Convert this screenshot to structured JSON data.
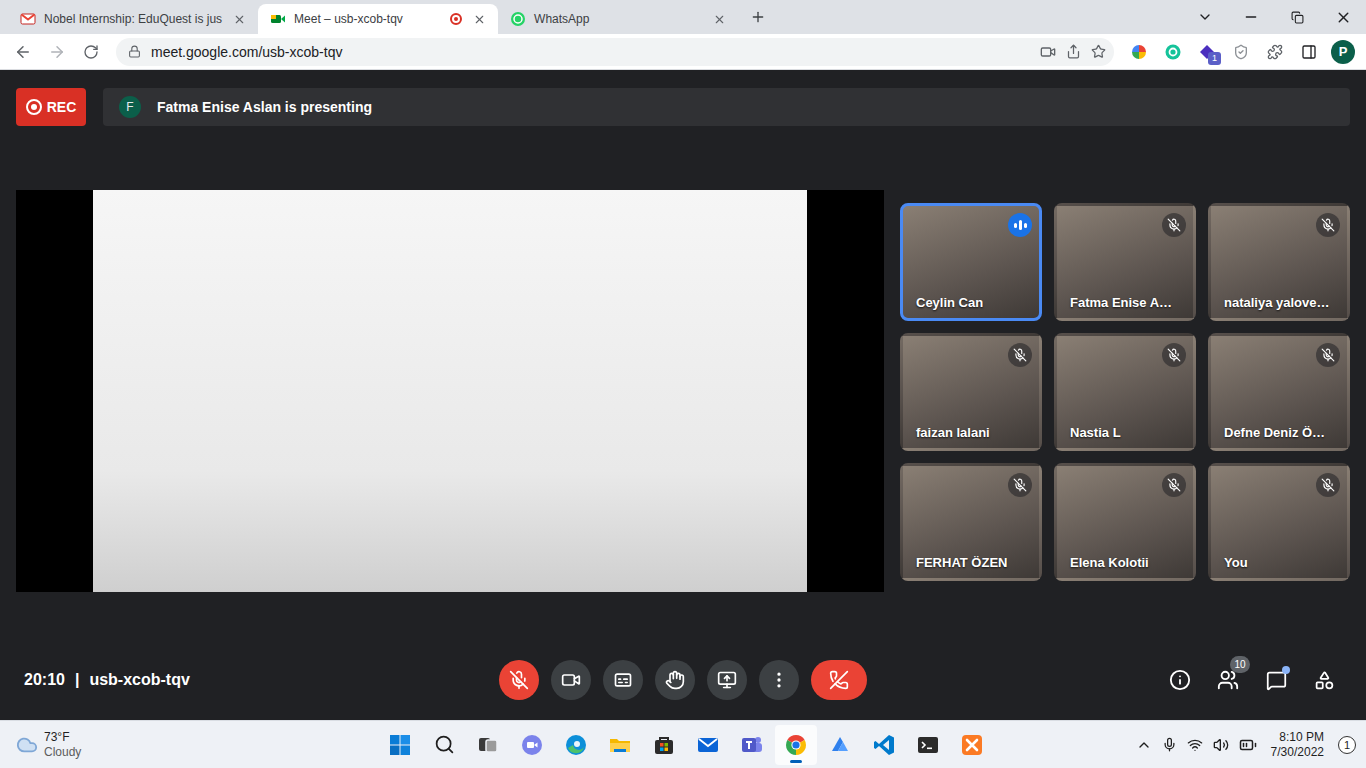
{
  "browser": {
    "tabs": [
      {
        "label": "Nobel Internship: EduQuest is jus",
        "kind": "gmail",
        "selected": false,
        "recording": false
      },
      {
        "label": "Meet – usb-xcob-tqv",
        "kind": "meet",
        "selected": true,
        "recording": true
      },
      {
        "label": "WhatsApp",
        "kind": "whatsapp",
        "selected": false,
        "recording": false
      }
    ],
    "address": "meet.google.com/usb-xcob-tqv",
    "extension_badge": "1",
    "profile": "P"
  },
  "meet": {
    "rec": "REC",
    "presenter_initial": "F",
    "presenting": "Fatma Enise Aslan is presenting",
    "participants": [
      {
        "name": "Ceylin Can",
        "muted": false,
        "speaking": true
      },
      {
        "name": "Fatma Enise A…",
        "muted": true,
        "speaking": false
      },
      {
        "name": "nataliya yalove…",
        "muted": true,
        "speaking": false
      },
      {
        "name": "faizan lalani",
        "muted": true,
        "speaking": false
      },
      {
        "name": "Nastia L",
        "muted": true,
        "speaking": false
      },
      {
        "name": "Defne Deniz Ö…",
        "muted": true,
        "speaking": false
      },
      {
        "name": "FERHAT ÖZEN",
        "muted": true,
        "speaking": false
      },
      {
        "name": "Elena Kolotii",
        "muted": true,
        "speaking": false
      },
      {
        "name": "You",
        "muted": true,
        "speaking": false
      }
    ],
    "time": "20:10",
    "separator": "|",
    "meeting_code": "usb-xcob-tqv",
    "controls": {
      "mic_muted": true,
      "camera_off": false,
      "captions_on": false,
      "hand_raised": false
    },
    "people_count": "10",
    "chat_unread": true
  },
  "taskbar": {
    "weather": {
      "temp": "73°F",
      "condition": "Cloudy"
    },
    "apps": [
      {
        "kind": "windows",
        "active": false
      },
      {
        "kind": "search",
        "active": false
      },
      {
        "kind": "taskview",
        "active": false
      },
      {
        "kind": "chat",
        "active": false
      },
      {
        "kind": "edge",
        "active": false
      },
      {
        "kind": "explorer",
        "active": false
      },
      {
        "kind": "store",
        "active": false
      },
      {
        "kind": "mail",
        "active": false
      },
      {
        "kind": "teams",
        "active": false
      },
      {
        "kind": "chrome",
        "active": true
      },
      {
        "kind": "arrow",
        "active": false
      },
      {
        "kind": "vscode",
        "active": false
      },
      {
        "kind": "terminal",
        "active": false
      },
      {
        "kind": "xampp",
        "active": false
      }
    ],
    "time": "8:10 PM",
    "date": "7/30/2022",
    "notifications": "1"
  }
}
